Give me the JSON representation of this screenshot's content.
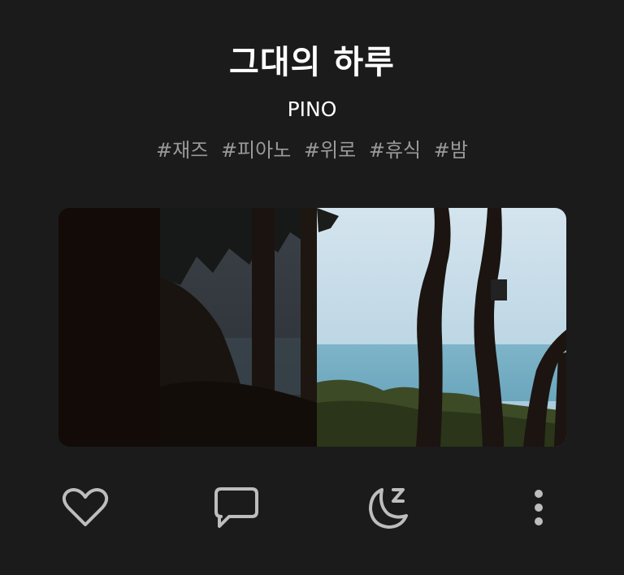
{
  "track": {
    "title": "그대의 하루",
    "artist": "PINO",
    "tags": [
      "#재즈",
      "#피아노",
      "#위로",
      "#휴식",
      "#밤"
    ]
  },
  "cover": {
    "icon": "album-cover-image"
  },
  "actions": [
    {
      "icon": "heart-icon",
      "name": "like-button"
    },
    {
      "icon": "comment-icon",
      "name": "comment-button"
    },
    {
      "icon": "sleep-moon-icon",
      "name": "sleep-timer-button"
    },
    {
      "icon": "more-vertical-icon",
      "name": "more-button"
    }
  ],
  "colors": {
    "background": "#1b1b1c",
    "text": "#ffffff",
    "tag_text": "#9a9a9a",
    "icon": "#bdbdbd"
  }
}
